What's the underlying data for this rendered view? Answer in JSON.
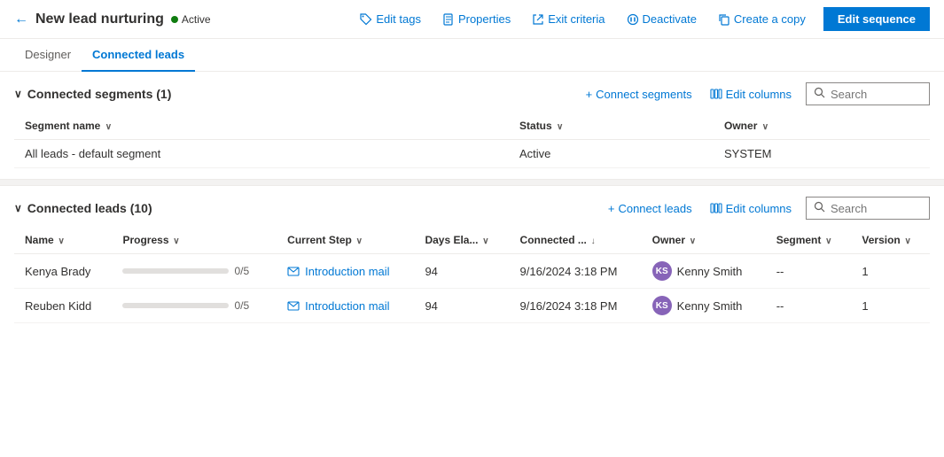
{
  "header": {
    "back_label": "←",
    "title": "New lead nurturing",
    "status": "Active",
    "actions": [
      {
        "id": "edit-tags",
        "label": "Edit tags",
        "icon": "tag"
      },
      {
        "id": "properties",
        "label": "Properties",
        "icon": "doc"
      },
      {
        "id": "exit-criteria",
        "label": "Exit criteria",
        "icon": "exit"
      },
      {
        "id": "deactivate",
        "label": "Deactivate",
        "icon": "deactivate"
      },
      {
        "id": "create-copy",
        "label": "Create a copy",
        "icon": "copy"
      }
    ],
    "primary_button": "Edit sequence"
  },
  "tabs": [
    {
      "id": "designer",
      "label": "Designer"
    },
    {
      "id": "connected-leads",
      "label": "Connected leads"
    }
  ],
  "active_tab": "connected-leads",
  "segments_section": {
    "title": "Connected segments (1)",
    "actions": [
      {
        "id": "connect-segments",
        "label": "Connect segments"
      },
      {
        "id": "edit-columns-seg",
        "label": "Edit columns"
      }
    ],
    "search_placeholder": "Search",
    "columns": [
      {
        "id": "segment-name",
        "label": "Segment name",
        "sortable": true
      },
      {
        "id": "status",
        "label": "Status",
        "sortable": true
      },
      {
        "id": "owner",
        "label": "Owner",
        "sortable": true
      }
    ],
    "rows": [
      {
        "segment_name": "All leads - default segment",
        "status": "Active",
        "owner": "SYSTEM"
      }
    ]
  },
  "leads_section": {
    "title": "Connected leads (10)",
    "actions": [
      {
        "id": "connect-leads",
        "label": "Connect leads"
      },
      {
        "id": "edit-columns-leads",
        "label": "Edit columns"
      }
    ],
    "search_placeholder": "Search",
    "columns": [
      {
        "id": "name",
        "label": "Name",
        "sortable": true
      },
      {
        "id": "progress",
        "label": "Progress",
        "sortable": true
      },
      {
        "id": "current-step",
        "label": "Current Step",
        "sortable": true
      },
      {
        "id": "days-elapsed",
        "label": "Days Ela...",
        "sortable": true
      },
      {
        "id": "connected-date",
        "label": "Connected ...",
        "sortable": true,
        "sort_dir": "desc"
      },
      {
        "id": "owner",
        "label": "Owner",
        "sortable": true
      },
      {
        "id": "segment",
        "label": "Segment",
        "sortable": true
      },
      {
        "id": "version",
        "label": "Version",
        "sortable": true
      }
    ],
    "rows": [
      {
        "name": "Kenya Brady",
        "progress_pct": 0,
        "progress_label": "0/5",
        "current_step": "Introduction mail",
        "days_elapsed": "94",
        "connected_date": "9/16/2024 3:18 PM",
        "owner_initials": "KS",
        "owner_name": "Kenny Smith",
        "segment": "--",
        "version": "1"
      },
      {
        "name": "Reuben Kidd",
        "progress_pct": 0,
        "progress_label": "0/5",
        "current_step": "Introduction mail",
        "days_elapsed": "94",
        "connected_date": "9/16/2024 3:18 PM",
        "owner_initials": "KS",
        "owner_name": "Kenny Smith",
        "segment": "--",
        "version": "1"
      }
    ]
  },
  "icons": {
    "tag": "🏷",
    "doc": "📄",
    "exit": "↗",
    "deactivate": "⏸",
    "copy": "📋",
    "search": "🔍",
    "plus": "+",
    "columns": "⊞",
    "chevron_down": "∨",
    "back_arrow": "←"
  }
}
